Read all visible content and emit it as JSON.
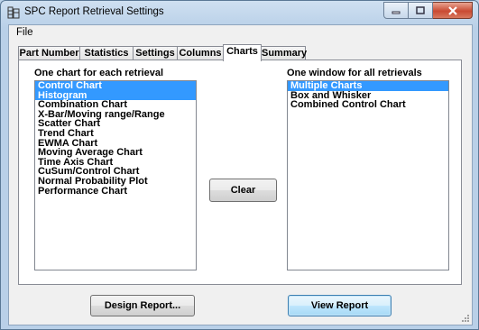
{
  "window": {
    "title": "SPC Report Retrieval Settings"
  },
  "menu": {
    "file": "File"
  },
  "tabs": [
    {
      "label": "Part Number"
    },
    {
      "label": "Statistics"
    },
    {
      "label": "Settings"
    },
    {
      "label": "Columns"
    },
    {
      "label": "Charts",
      "active": true
    },
    {
      "label": "Summary"
    }
  ],
  "charts_tab": {
    "left_label": "One chart for each retrieval",
    "right_label": "One window for all retrievals",
    "left_list": [
      {
        "label": "Control Chart",
        "selected": true
      },
      {
        "label": "Histogram",
        "selected": true
      },
      {
        "label": "Combination Chart",
        "selected": false
      },
      {
        "label": "X-Bar/Moving range/Range",
        "selected": false
      },
      {
        "label": "Scatter Chart",
        "selected": false
      },
      {
        "label": "Trend Chart",
        "selected": false
      },
      {
        "label": "EWMA Chart",
        "selected": false
      },
      {
        "label": "Moving Average Chart",
        "selected": false
      },
      {
        "label": "Time Axis Chart",
        "selected": false
      },
      {
        "label": "CuSum/Control Chart",
        "selected": false
      },
      {
        "label": "Normal Probability Plot",
        "selected": false
      },
      {
        "label": "Performance Chart",
        "selected": false
      }
    ],
    "right_list": [
      {
        "label": "Multiple Charts",
        "selected": true
      },
      {
        "label": "Box and Whisker",
        "selected": false
      },
      {
        "label": "Combined Control Chart",
        "selected": false
      }
    ],
    "clear_button": "Clear"
  },
  "footer": {
    "design_button": "Design Report...",
    "view_button": "View Report"
  },
  "colors": {
    "selection": "#3399ff",
    "close_button": "#c94a32"
  }
}
